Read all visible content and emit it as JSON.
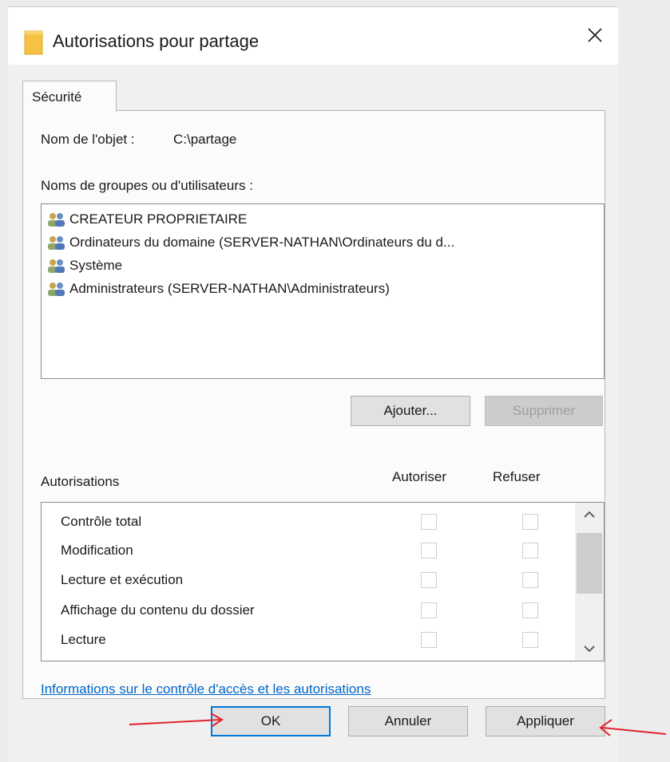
{
  "window": {
    "title": "Autorisations pour partage",
    "icon": "folder-icon",
    "close_icon": "close-icon"
  },
  "tabs": [
    {
      "label": "Sécurité",
      "selected": true
    }
  ],
  "security": {
    "object_label": "Nom de l'objet :",
    "object_value": "C:\\partage",
    "groups_label": "Noms de groupes ou d'utilisateurs :",
    "groups": [
      {
        "name": "CREATEUR PROPRIETAIRE",
        "icon": "users-icon"
      },
      {
        "name": "Ordinateurs du domaine (SERVER-NATHAN\\Ordinateurs du d...",
        "icon": "users-icon"
      },
      {
        "name": "Système",
        "icon": "users-icon"
      },
      {
        "name": "Administrateurs (SERVER-NATHAN\\Administrateurs)",
        "icon": "users-icon"
      }
    ],
    "add_button": "Ajouter...",
    "remove_button": "Supprimer",
    "remove_enabled": false,
    "permissions_label": "Autorisations",
    "allow_header": "Autoriser",
    "deny_header": "Refuser",
    "permissions": [
      {
        "name": "Contrôle total",
        "allow": false,
        "deny": false
      },
      {
        "name": "Modification",
        "allow": false,
        "deny": false
      },
      {
        "name": "Lecture et exécution",
        "allow": false,
        "deny": false
      },
      {
        "name": "Affichage du contenu du dossier",
        "allow": false,
        "deny": false
      },
      {
        "name": "Lecture",
        "allow": false,
        "deny": false
      }
    ],
    "info_link": "Informations sur le contrôle d'accès et les autorisations"
  },
  "footer": {
    "ok": "OK",
    "cancel": "Annuler",
    "apply": "Appliquer"
  },
  "annotations": {
    "arrow_color": "#e0242e",
    "arrows": [
      "pointing to OK",
      "pointing to Appliquer"
    ]
  },
  "colors": {
    "accent": "#0078d7",
    "link": "#0066cc",
    "folder": "#f5c244"
  }
}
